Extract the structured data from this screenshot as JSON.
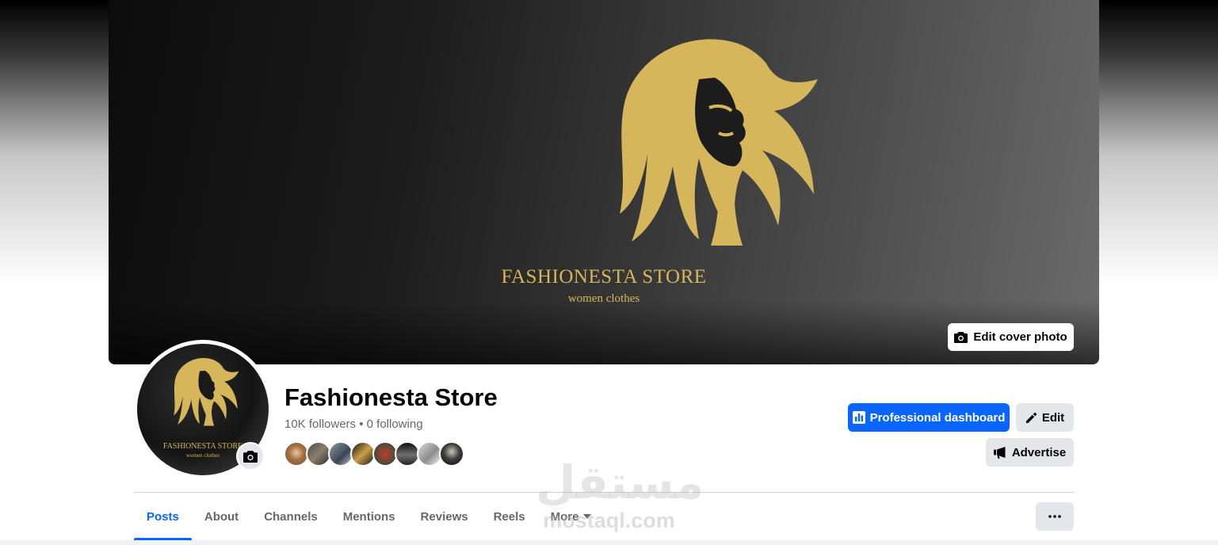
{
  "cover": {
    "brand_text": "FASHIONESTA STORE",
    "tagline": "women clothes",
    "edit_cover_label": "Edit cover photo"
  },
  "avatar": {
    "brand_text": "FASHIONESTA STORE",
    "tagline": "women clothes"
  },
  "profile": {
    "name": "Fashionesta Store",
    "followers": "10K followers",
    "separator": "•",
    "following": "0 following"
  },
  "actions": {
    "professional_dashboard": "Professional dashboard",
    "edit": "Edit",
    "advertise": "Advertise"
  },
  "tabs": [
    {
      "label": "Posts",
      "active": true
    },
    {
      "label": "About",
      "active": false
    },
    {
      "label": "Channels",
      "active": false
    },
    {
      "label": "Mentions",
      "active": false
    },
    {
      "label": "Reviews",
      "active": false
    },
    {
      "label": "Reels",
      "active": false
    },
    {
      "label": "More",
      "active": false
    }
  ],
  "watermark": {
    "arabic": "مستقل",
    "latin": "mostaql.com"
  },
  "colors": {
    "accent": "#0866ff",
    "gold": "#d6b65a",
    "button_gray": "#e4e6eb",
    "text_primary": "#050505",
    "text_secondary": "#65676b"
  }
}
